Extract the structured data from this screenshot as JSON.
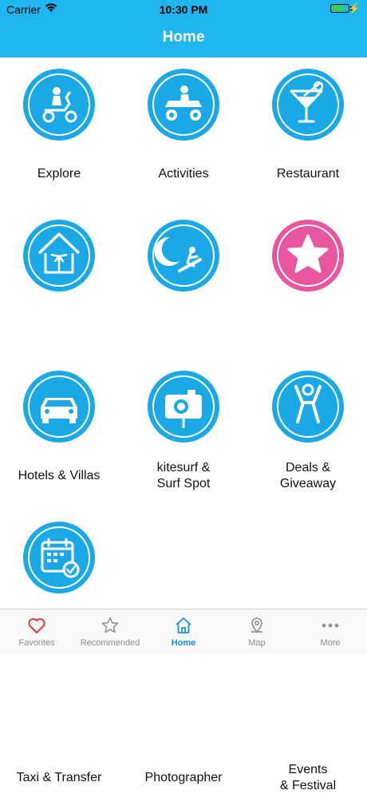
{
  "status_bar": {
    "carrier": "Carrier",
    "time": "10:30 PM"
  },
  "nav": {
    "title": "Home"
  },
  "tiles": [
    {
      "label": "Explore",
      "icon": "scooter-icon",
      "color": "#1ba8e6"
    },
    {
      "label": "Activities",
      "icon": "atv-icon",
      "color": "#1ba8e6"
    },
    {
      "label": "Restaurant",
      "icon": "cocktail-icon",
      "color": "#1ba8e6"
    },
    {
      "label": "Hotels & Villas",
      "icon": "hut-icon",
      "color": "#1ba8e6"
    },
    {
      "label": "kitesurf &\nSurf Spot",
      "icon": "kitesurf-icon",
      "color": "#1ba8e6"
    },
    {
      "label": "Deals &\nGiveaway",
      "icon": "star-icon",
      "color": "#e8569f"
    },
    {
      "label": "Taxi & Transfer",
      "icon": "car-icon",
      "color": "#1ba8e6"
    },
    {
      "label": "Photographer",
      "icon": "camera-icon",
      "color": "#1ba8e6"
    },
    {
      "label": "Events\n& Festival",
      "icon": "person-cheer-icon",
      "color": "#1ba8e6"
    },
    {
      "label": "",
      "icon": "calendar-check-icon",
      "color": "#1ba8e6"
    }
  ],
  "tabbar": {
    "items": [
      {
        "label": "Favorites",
        "icon": "heart-icon",
        "color": "#e0393e"
      },
      {
        "label": "Recommended",
        "icon": "star-outline-icon",
        "color": "#8e8e8e"
      },
      {
        "label": "Home",
        "icon": "home-icon",
        "color": "#1a8fe3",
        "active": true
      },
      {
        "label": "Map",
        "icon": "map-pin-icon",
        "color": "#8e8e8e"
      },
      {
        "label": "More",
        "icon": "more-dots-icon",
        "color": "#8e8e8e"
      }
    ]
  }
}
